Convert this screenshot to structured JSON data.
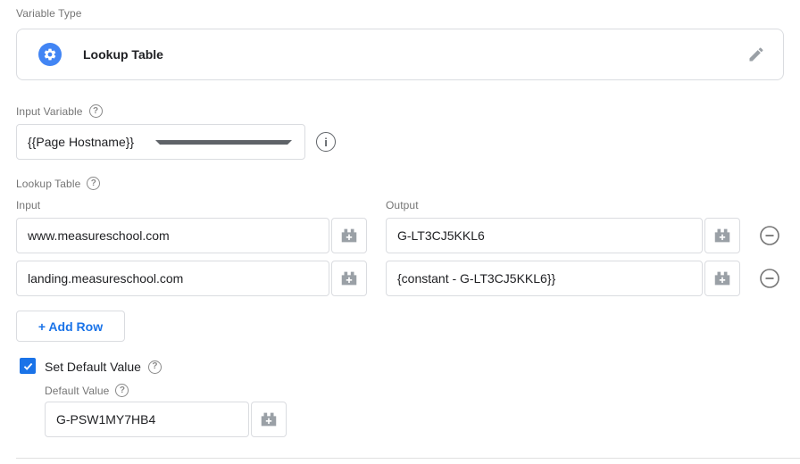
{
  "colors": {
    "accent_blue": "#1a73e8",
    "icon_badge_blue": "#4285f4",
    "border_gray": "#dadce0",
    "label_gray": "#757575",
    "text_dark": "#202124",
    "icon_gray": "#9aa0a6"
  },
  "icons": {
    "help_glyph": "?",
    "info_glyph": "i",
    "gear": "gear-icon",
    "pencil": "pencil-icon",
    "brick": "variable-picker-brick-icon",
    "minus": "remove-row-icon"
  },
  "variable_type": {
    "label": "Variable Type",
    "value": "Lookup Table"
  },
  "input_variable": {
    "label": "Input Variable",
    "value": "{{Page Hostname}}"
  },
  "lookup_table": {
    "label": "Lookup Table",
    "columns": {
      "input": "Input",
      "output": "Output"
    },
    "rows": [
      {
        "input": "www.measureschool.com",
        "output": "G-LT3CJ5KKL6"
      },
      {
        "input": "landing.measureschool.com",
        "output": "{constant - G-LT3CJ5KKL6}}"
      }
    ],
    "add_row_label": "+ Add Row"
  },
  "default_value": {
    "checkbox_label": "Set Default Value",
    "checked": true,
    "field_label": "Default Value",
    "value": "G-PSW1MY7HB4"
  }
}
